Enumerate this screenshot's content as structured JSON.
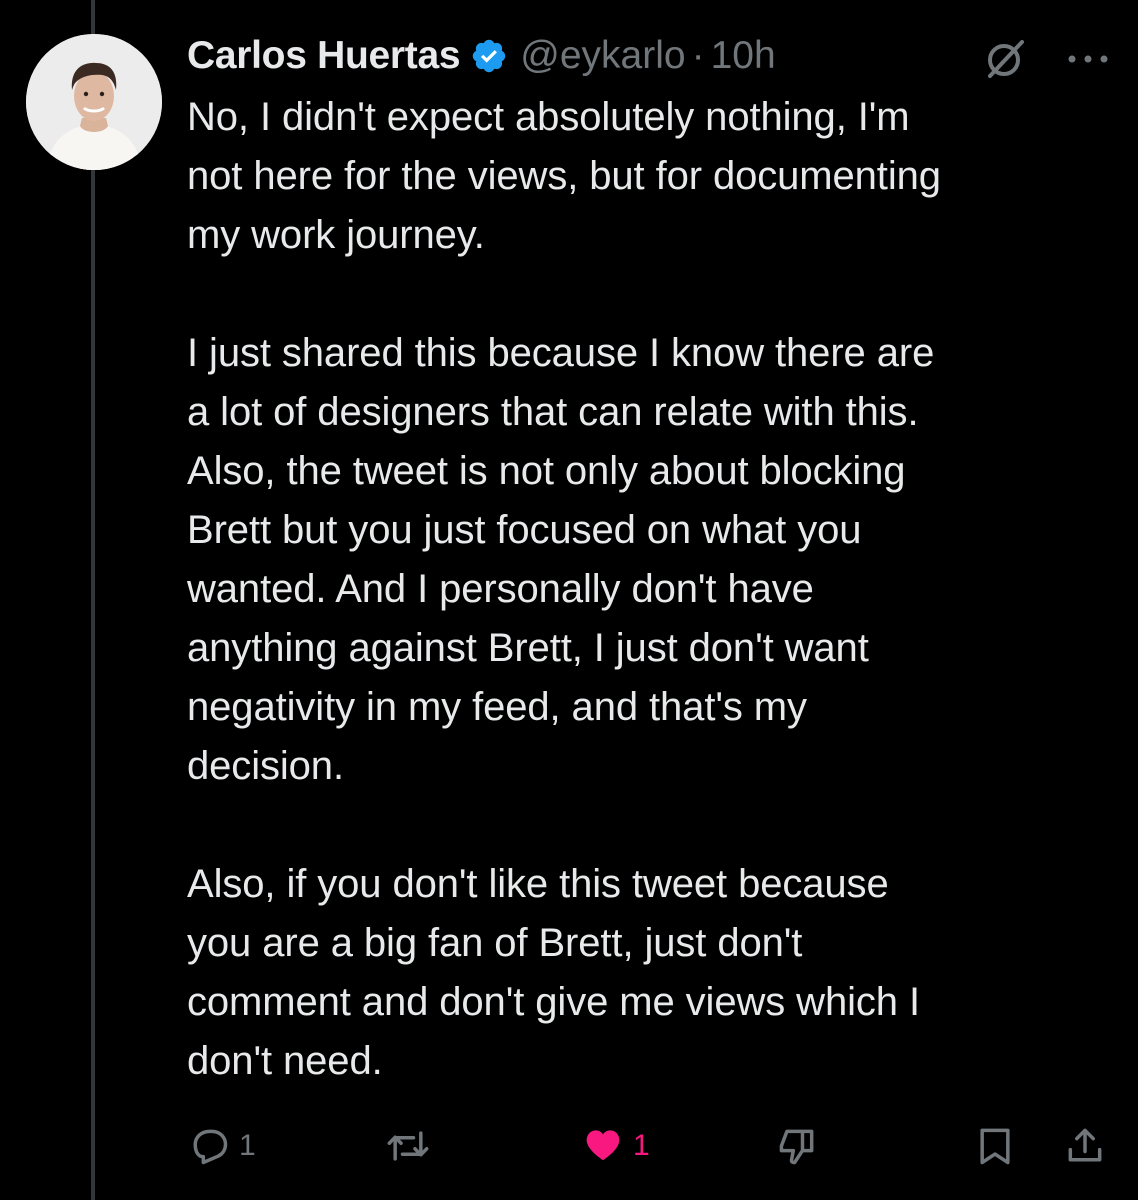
{
  "post": {
    "author": {
      "display_name": "Carlos Huertas",
      "handle": "@eykarlo",
      "verified": true
    },
    "separator": "·",
    "timestamp": "10h",
    "paragraphs": [
      "No, I didn't expect absolutely nothing, I'm\nnot here for the views, but for documenting\nmy work journey.",
      "I just shared this because I know there are\na lot of designers that can relate with this.\nAlso, the tweet is not only about blocking\nBrett but you just focused on what you\nwanted. And I personally don't have\nanything against Brett, I just don't want\nnegativity in my feed, and that's my\ndecision.",
      "Also, if you don't like this tweet because\nyou are a big fan of Brett, just don't\ncomment and don't give me views which I\ndon't need."
    ]
  },
  "actions": {
    "reply_count": "1",
    "like_count": "1",
    "liked": true
  },
  "colors": {
    "background": "#000000",
    "text": "#e7e9ea",
    "muted": "#71767b",
    "verified_blue": "#1d9bf0",
    "like_pink": "#f91880",
    "thread_line": "#333639"
  },
  "icons": {
    "verified": "verified-badge-icon",
    "grok": "grok-icon",
    "more": "more-options-icon",
    "reply": "reply-icon",
    "repost": "repost-icon",
    "like": "heart-icon",
    "downvote": "downvote-icon",
    "bookmark": "bookmark-icon",
    "share": "share-icon"
  }
}
